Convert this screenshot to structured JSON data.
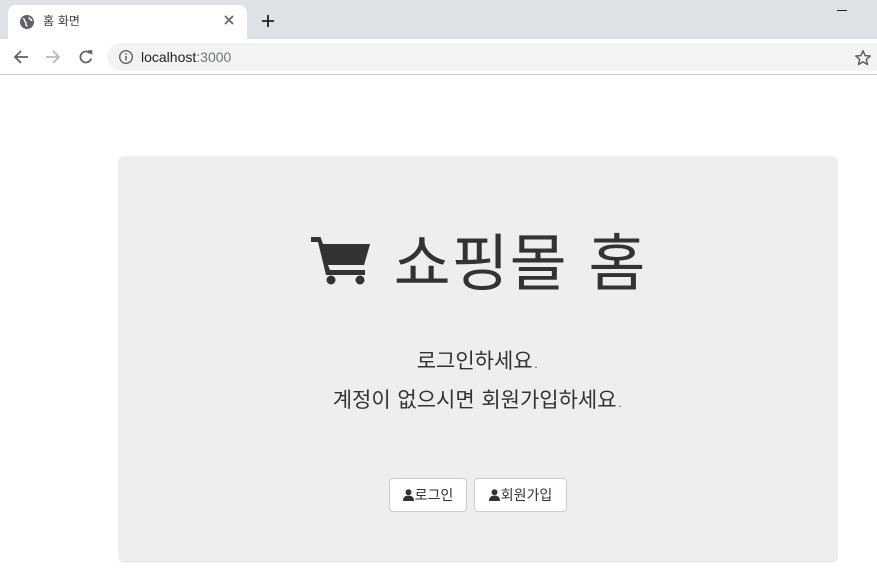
{
  "browser": {
    "tab": {
      "title": "홈 화면",
      "favicon": "globe-icon",
      "close_icon": "close-icon"
    },
    "new_tab_icon": "plus-icon",
    "toolbar": {
      "back_icon": "arrow-left-icon",
      "forward_icon": "arrow-right-icon",
      "reload_icon": "reload-icon",
      "site_info_icon": "info-icon",
      "url_host": "localhost",
      "url_port": ":3000",
      "bookmark_icon": "star-icon"
    }
  },
  "page": {
    "heading": {
      "icon": "shopping-cart-icon",
      "text": "쇼핑몰 홈"
    },
    "lead_line_1": "로그인하세요.",
    "lead_line_2": "계정이 없으시면 회원가입하세요.",
    "buttons": {
      "login": {
        "label": "로그인",
        "icon": "user-icon"
      },
      "signup": {
        "label": "회원가입",
        "icon": "user-icon"
      }
    }
  },
  "colors": {
    "tabstrip_bg": "#dee1e6",
    "omnibox_bg": "#f1f3f4",
    "jumbotron_bg": "#eeeeee",
    "text": "#333333"
  }
}
